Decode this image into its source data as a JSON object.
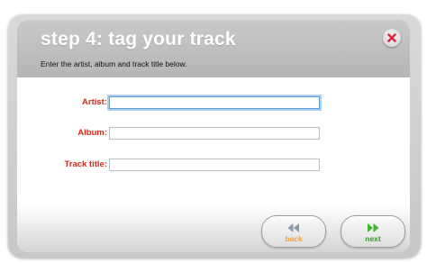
{
  "dialog": {
    "title": "step 4: tag your track",
    "instructions": "Enter the artist, album and track title below."
  },
  "form": {
    "artist_label": "Artist:",
    "album_label": "Album:",
    "track_title_label": "Track title:",
    "artist_value": "",
    "album_value": "",
    "track_title_value": ""
  },
  "buttons": {
    "back_label": "back",
    "next_label": "next"
  },
  "colors": {
    "label_red": "#d42a1e",
    "back_orange": "#f0a040",
    "next_green": "#3a9a2a",
    "close_red": "#d8283c"
  },
  "icons": {
    "close": "close-icon",
    "back": "double-chevron-left-icon",
    "next": "double-chevron-right-icon"
  }
}
